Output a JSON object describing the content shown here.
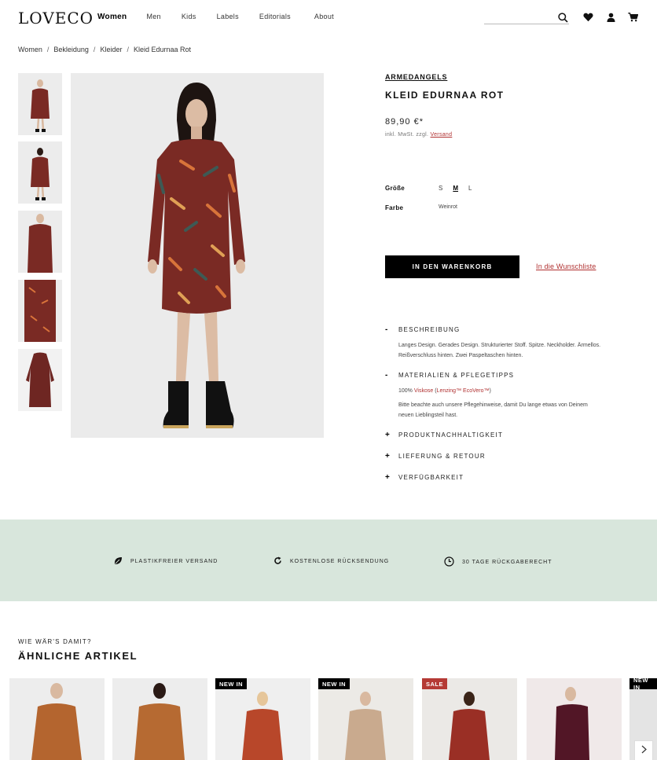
{
  "header": {
    "logo": "LOVECO",
    "nav": [
      "Women",
      "Men",
      "Kids",
      "Labels",
      "Editorials",
      "About"
    ],
    "search_placeholder": ""
  },
  "breadcrumb": [
    "Women",
    "Bekleidung",
    "Kleider",
    "Kleid Edurnaa Rot"
  ],
  "product": {
    "brand": "ARMEDANGELS",
    "name": "KLEID EDURNAA ROT",
    "price": "89,90 €*",
    "tax_prefix": "inkl. MwSt. zzgl.",
    "tax_link": "Versand",
    "size_label": "Größe",
    "sizes": [
      "S",
      "M",
      "L"
    ],
    "selected_size": "M",
    "color_label": "Farbe",
    "color_value": "Weinrot",
    "cart_button": "IN DEN WARENKORB",
    "wishlist_link": "In die Wunschliste",
    "colors": {
      "dress": "#7a2a24",
      "accent_red": "#b03030"
    }
  },
  "accordion": {
    "description": {
      "sym": "-",
      "title": "BESCHREIBUNG",
      "text": "Langes Design. Gerades Design. Strukturierter Stoff. Spitze. Neckholder. Ärmellos. Reißverschluss hinten. Zwei Paspeltaschen hinten."
    },
    "materials": {
      "sym": "-",
      "title": "MATERIALIEN & PFLEGETIPPS",
      "pct": "100%",
      "fabric": "Viskose",
      "open": "(",
      "brand1": "Lenzing™",
      "brand2": "EcoVero™",
      "close": ")",
      "care": "Bitte beachte auch unsere Pflegehinweise, damit Du lange etwas von Deinem neuen Lieblingsteil hast."
    },
    "sustainability": {
      "sym": "+",
      "title": "PRODUKTNACHHALTIGKEIT"
    },
    "delivery": {
      "sym": "+",
      "title": "LIEFERUNG & RETOUR"
    },
    "availability": {
      "sym": "+",
      "title": "VERFÜGBARKEIT"
    }
  },
  "features": [
    "PLASTIKFREIER VERSAND",
    "KOSTENLOSE RÜCKSENDUNG",
    "30 TAGE RÜCKGABERECHT"
  ],
  "similar": {
    "subheading": "WIE WÄR'S DAMIT?",
    "heading": "ÄHNLICHE ARTIKEL",
    "cards": [
      {
        "badge": "",
        "color": "#b4652f"
      },
      {
        "badge": "",
        "color": "#b66a32"
      },
      {
        "badge": "NEW IN",
        "color": "#b8472a"
      },
      {
        "badge": "NEW IN",
        "color": "#c9aa8e"
      },
      {
        "badge": "SALE",
        "color": "#9a2f25"
      },
      {
        "badge": "",
        "color": "#521626"
      },
      {
        "badge": "NEW IN",
        "color": "#bfbfbf"
      }
    ]
  }
}
